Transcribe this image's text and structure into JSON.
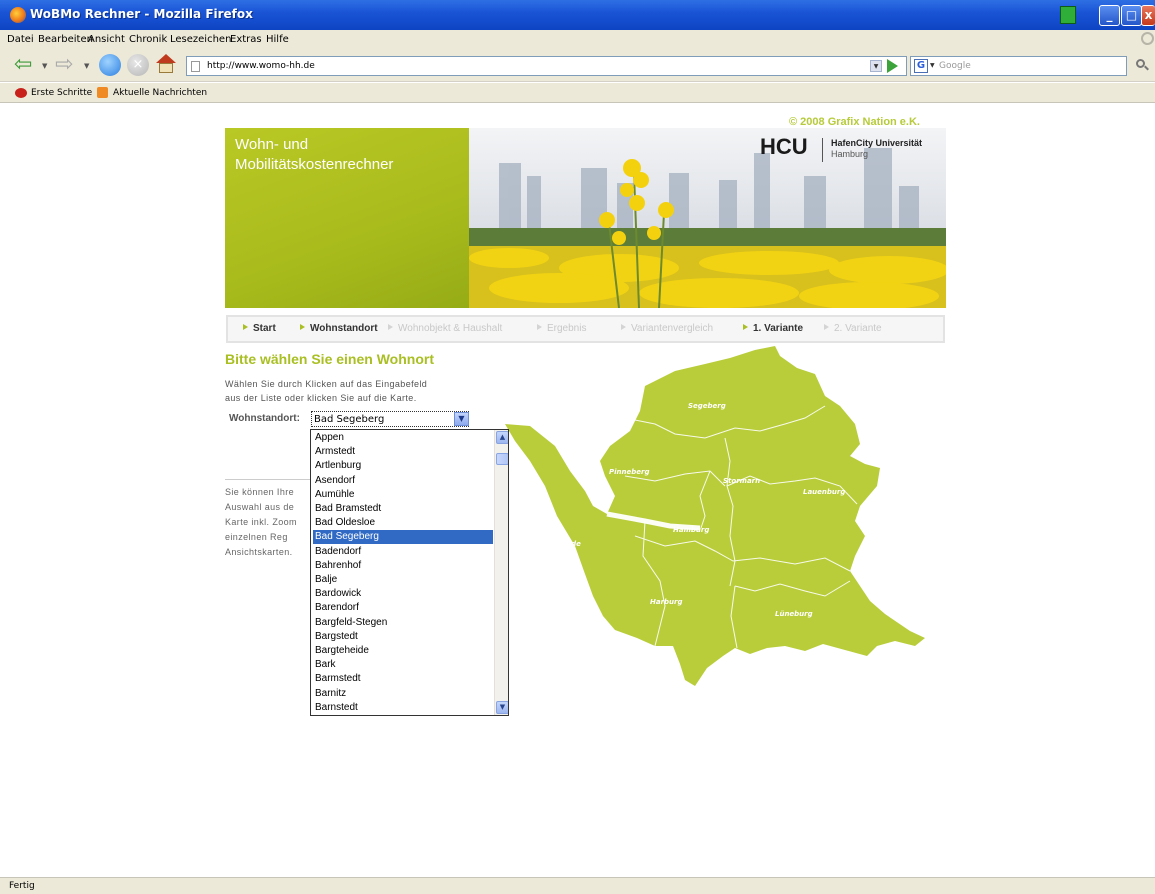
{
  "window": {
    "title": "WoBMo Rechner - Mozilla Firefox"
  },
  "menu": [
    "Datei",
    "Bearbeiten",
    "Ansicht",
    "Chronik",
    "Lesezeichen",
    "Extras",
    "Hilfe"
  ],
  "nav": {
    "url": "http://www.womo-hh.de",
    "search_placeholder": "Google",
    "search_engine_letter": "G"
  },
  "bookmarks": [
    "Erste Schritte",
    "Aktuelle Nachrichten"
  ],
  "status": "Fertig",
  "page": {
    "copyright": "© 2008 Grafix Nation e.K.",
    "banner_title_1": "Wohn- und",
    "banner_title_2": "Mobilitätskostenrechner",
    "logo_hcu": "HCU",
    "logo_name": "HafenCity Universität",
    "logo_city": "Hamburg",
    "steps": [
      {
        "label": "Start",
        "active": true
      },
      {
        "label": "Wohnstandort",
        "active": true
      },
      {
        "label": "Wohnobjekt & Haushalt",
        "active": false
      },
      {
        "label": "Ergebnis",
        "active": false
      },
      {
        "label": "Variantenvergleich",
        "active": false
      },
      {
        "label": "1. Variante",
        "active": true
      },
      {
        "label": "2. Variante",
        "active": false
      }
    ],
    "heading": "Bitte wählen Sie einen Wohnort",
    "intro_1": "Wählen Sie durch Klicken auf das Eingabefeld",
    "intro_2": "aus der Liste oder klicken Sie auf die Karte.",
    "field_label": "Wohnstandort:",
    "selected": "Bad Segeberg",
    "info_lines": [
      "Sie können Ihre",
      "Auswahl aus de",
      "Karte inkl. Zoom",
      "einzelnen Reg",
      "Ansichtskarten."
    ],
    "options": [
      "Appen",
      "Armstedt",
      "Artlenburg",
      "Asendorf",
      "Aumühle",
      "Bad Bramstedt",
      "Bad Oldesloe",
      "Bad Segeberg",
      "Badendorf",
      "Bahrenhof",
      "Balje",
      "Bardowick",
      "Barendorf",
      "Bargfeld-Stegen",
      "Bargstedt",
      "Bargteheide",
      "Bark",
      "Barmstedt",
      "Barnitz",
      "Barnstedt"
    ]
  },
  "map": {
    "color": "#b9cd3a",
    "regions": [
      "Segeberg",
      "Pinneberg",
      "Stormarn",
      "Lauenburg",
      "Hamburg",
      "Stade",
      "Harburg",
      "Lüneburg"
    ]
  },
  "colors": {
    "accent": "#a9bf22",
    "selection": "#316ac5"
  }
}
